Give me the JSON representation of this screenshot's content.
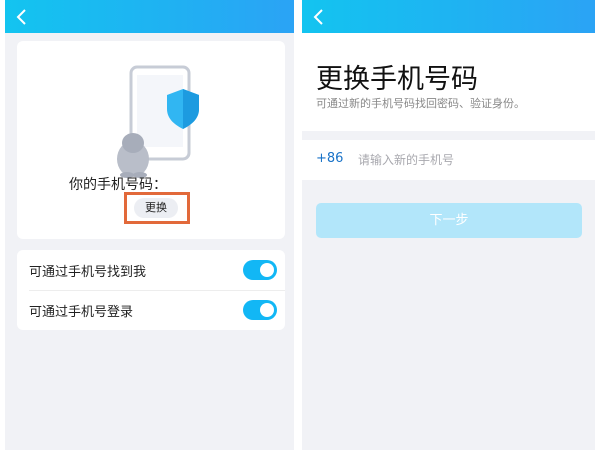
{
  "left_screen": {
    "phone_label": "你的手机号码：",
    "change_button": "更换",
    "settings": [
      {
        "label": "可通过手机号找到我",
        "enabled": true
      },
      {
        "label": "可通过手机号登录",
        "enabled": true
      }
    ]
  },
  "right_screen": {
    "title": "更换手机号码",
    "subtitle": "可通过新的手机号码找回密码、验证身份。",
    "country_code": "+86",
    "phone_placeholder": "请输入新的手机号",
    "next_button": "下一步"
  },
  "colors": {
    "header_gradient": [
      "#13c4f0",
      "#2ba3f5"
    ],
    "toggle_on": "#12b7f5",
    "highlight": "#e2693a",
    "next_button_disabled": "#b2e6fa"
  },
  "icons": [
    "chevron-left-icon",
    "phone-illustration",
    "shield-icon",
    "penguin-icon"
  ]
}
